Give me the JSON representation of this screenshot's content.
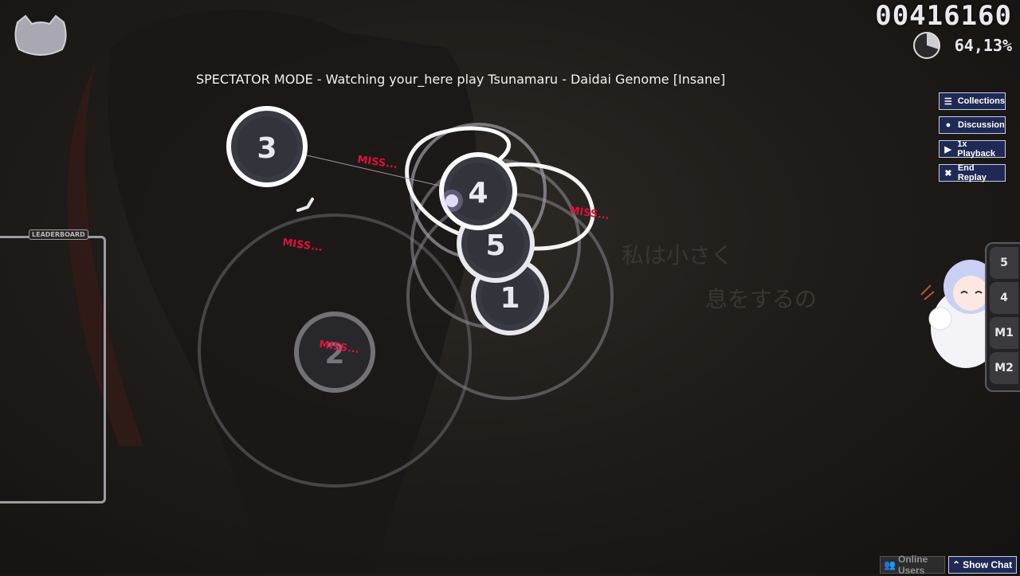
{
  "hud": {
    "score": "00416160",
    "accuracy": "64,13%",
    "progress_fraction": 0.3
  },
  "spectator_text": "SPECTATOR MODE - Watching your_here play Tsunamaru - Daidai Genome [Insane]",
  "leaderboard": {
    "label": "LEADERBOARD"
  },
  "side_buttons": [
    {
      "label": "Collections",
      "icon": "list-icon"
    },
    {
      "label": "Discussion",
      "icon": "chat-bubble-icon"
    },
    {
      "label": "1x Playback",
      "icon": "play-icon"
    },
    {
      "label": "End Replay",
      "icon": "close-icon"
    }
  ],
  "keys": [
    "5",
    "4",
    "M1",
    "M2"
  ],
  "hit_circles": {
    "c1": "1",
    "c2": "2",
    "c3": "3",
    "c4": "4",
    "c5": "5"
  },
  "judgements": [
    "MISS...",
    "MISS...",
    "MISS...",
    "MISS..."
  ],
  "lyrics": {
    "line1": "私は小さく",
    "line2": "息をするの"
  },
  "bottom": {
    "online_users": "Online Users",
    "show_chat": "Show Chat"
  },
  "colors": {
    "accent": "#1e2a55",
    "miss": "#e0103a",
    "circle_fill": "#3a3a44"
  }
}
